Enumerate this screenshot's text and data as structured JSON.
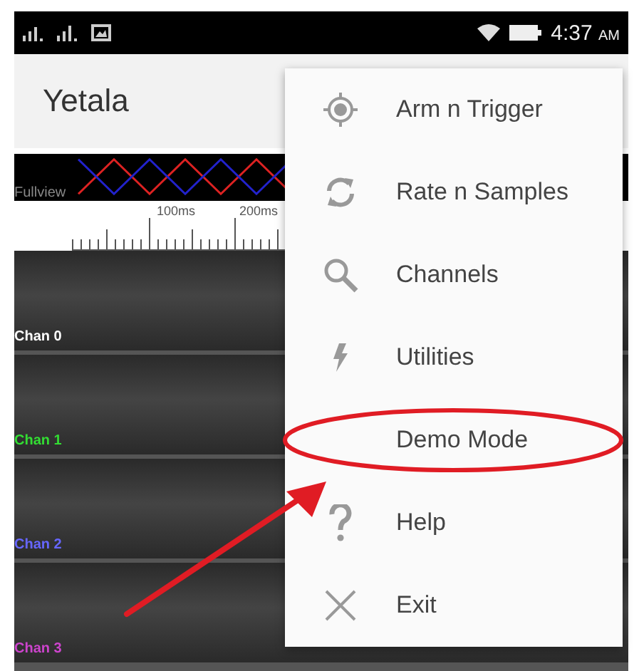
{
  "status_bar": {
    "time": "4:37",
    "meridiem": "AM"
  },
  "app_bar": {
    "title": "Yetala"
  },
  "fullview": {
    "label": "Fullview"
  },
  "ruler": {
    "labels": [
      "100ms",
      "200ms"
    ]
  },
  "channels": [
    {
      "name": "Chan 0",
      "color": "#ffffff"
    },
    {
      "name": "Chan 1",
      "color": "#33dd33"
    },
    {
      "name": "Chan 2",
      "color": "#6666ff"
    },
    {
      "name": "Chan 3",
      "color": "#cc44cc"
    }
  ],
  "menu": [
    {
      "kind": "target",
      "label": "Arm n Trigger",
      "highlighted": false
    },
    {
      "kind": "refresh",
      "label": "Rate n Samples",
      "highlighted": false
    },
    {
      "kind": "search",
      "label": "Channels",
      "highlighted": false
    },
    {
      "kind": "bolt",
      "label": "Utilities",
      "highlighted": false
    },
    {
      "kind": "none",
      "label": "Demo Mode",
      "highlighted": true
    },
    {
      "kind": "help",
      "label": "Help",
      "highlighted": false
    },
    {
      "kind": "close",
      "label": "Exit",
      "highlighted": false
    }
  ]
}
